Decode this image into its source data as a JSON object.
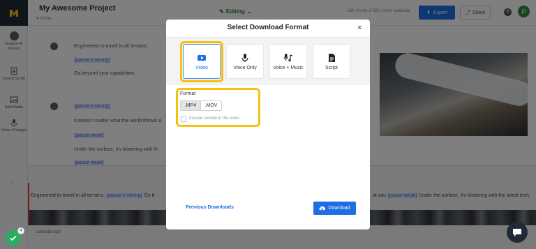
{
  "header": {
    "project_title": "My Awesome Project",
    "breadcrumb": "Home",
    "mode": "Editing",
    "availability": "56h 41min of 56h 10min available",
    "export_label": "Export",
    "share_label": "Share",
    "avatar_initial": "P"
  },
  "sidebar": {
    "items": [
      {
        "label": "Explore AI Voices",
        "icon": "user-icon"
      },
      {
        "label": "Import Script",
        "icon": "import-icon"
      },
      {
        "label": "Add Media",
        "icon": "media-icon"
      },
      {
        "label": "Voice Changer",
        "icon": "voice-changer-icon"
      }
    ]
  },
  "script": {
    "lines": [
      "Engineered to travel in all terrains.",
      "[pause x-strong]",
      "Go beyond your capabilities.",
      "[pause x-strong]",
      "It doesn't matter what the world throws a",
      "[pause weak]",
      "Under the surface, it's blistering with th",
      "[pause weak]"
    ]
  },
  "timeline": {
    "text_start": "Engineered to travel in all terrains.",
    "text_tag": "[pause x-strong]",
    "text_mid": "Go b",
    "text_right_start": "at you",
    "text_right_tag": "[pause weak]",
    "text_right_end": "Under the surface, it's blistering with the latest tech.",
    "audio_file": "asteroid.mp3"
  },
  "modal": {
    "title": "Select Download Format",
    "close_label": "×",
    "formats": [
      {
        "label": "Video",
        "icon": "video-icon",
        "selected": true
      },
      {
        "label": "Voice Only",
        "icon": "microphone-icon",
        "selected": false
      },
      {
        "label": "Voice + Music",
        "icon": "voice-music-icon",
        "selected": false
      },
      {
        "label": "Script",
        "icon": "document-icon",
        "selected": false
      }
    ],
    "format_label": "Format",
    "options": [
      ".MP4",
      ".MOV"
    ],
    "selected_option": ".MP4",
    "subtitle_label": "Include subtitle in the video",
    "subtitle_checked": false,
    "previous_downloads": "Previous Downloads",
    "download_label": "Download"
  },
  "widgets": {
    "notification_count": "4"
  },
  "colors": {
    "accent": "#1e6fe0",
    "highlight": "#f4c20d",
    "editing": "#2e7d32",
    "success": "#27ae60"
  }
}
